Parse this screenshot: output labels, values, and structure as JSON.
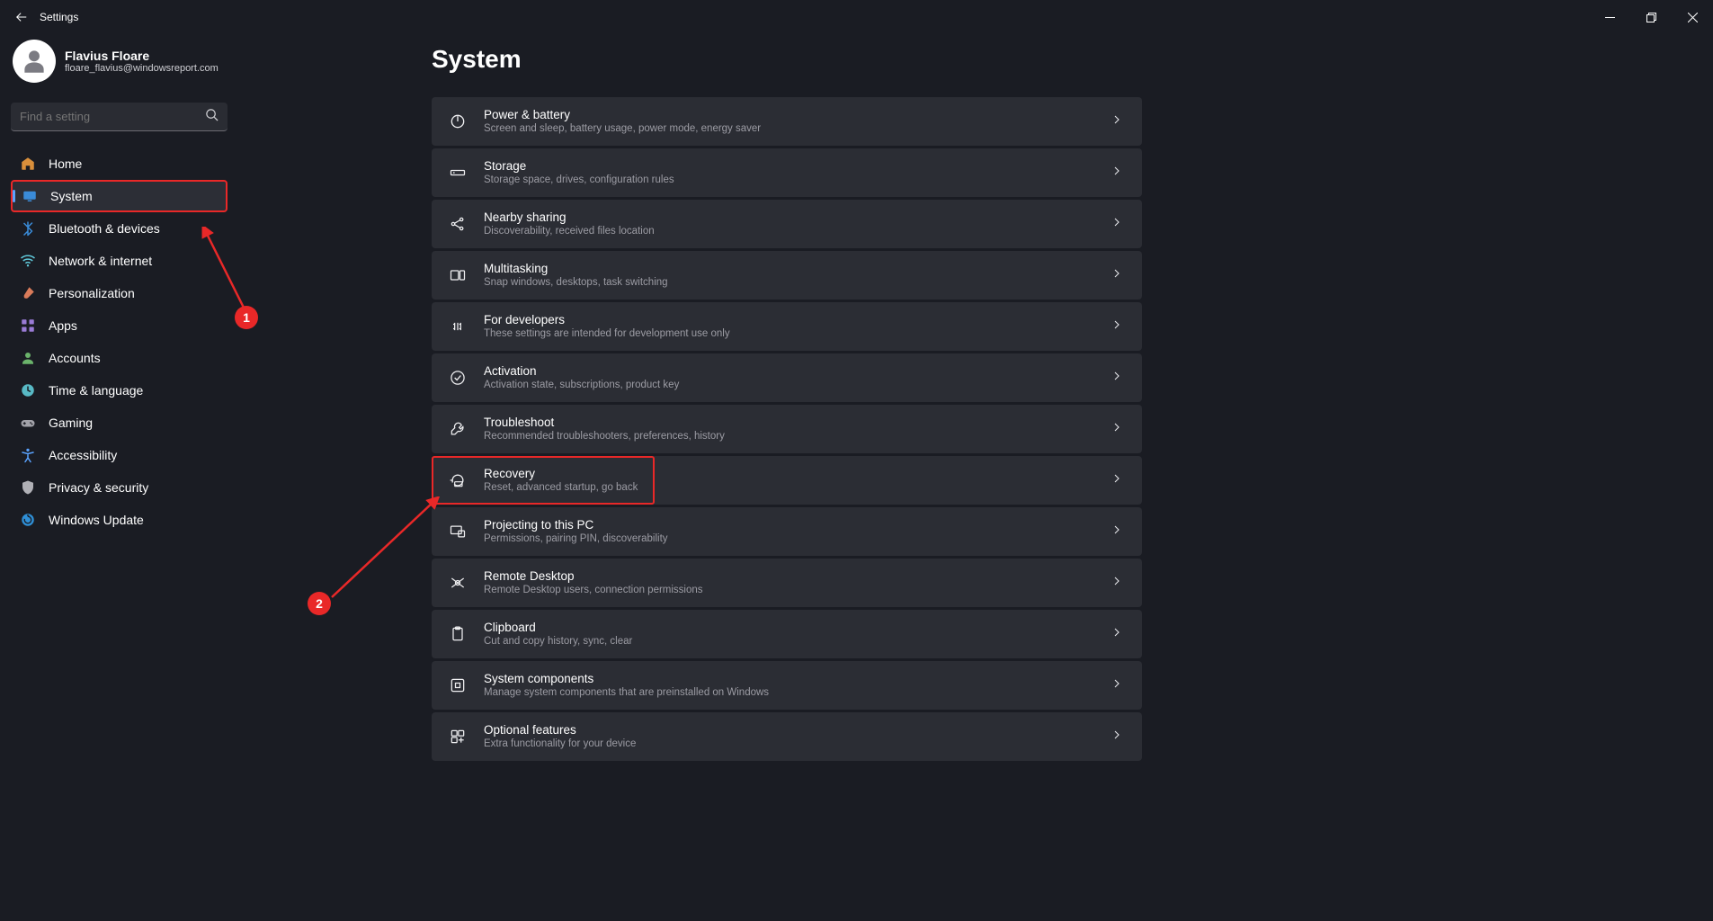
{
  "titlebar": {
    "title": "Settings"
  },
  "profile": {
    "name": "Flavius Floare",
    "email": "floare_flavius@windowsreport.com"
  },
  "search": {
    "placeholder": "Find a setting"
  },
  "nav": [
    {
      "label": "Home",
      "icon": "home",
      "color": "#d98f3b"
    },
    {
      "label": "System",
      "icon": "display",
      "color": "#3a8bd8",
      "selected": true,
      "highlight": true
    },
    {
      "label": "Bluetooth & devices",
      "icon": "bluetooth",
      "color": "#3a8bd8"
    },
    {
      "label": "Network & internet",
      "icon": "wifi",
      "color": "#5fc7d8"
    },
    {
      "label": "Personalization",
      "icon": "brush",
      "color": "#d97b5a"
    },
    {
      "label": "Apps",
      "icon": "apps",
      "color": "#9a7bd6"
    },
    {
      "label": "Accounts",
      "icon": "person",
      "color": "#6bb36b"
    },
    {
      "label": "Time & language",
      "icon": "clock-globe",
      "color": "#58b9c5"
    },
    {
      "label": "Gaming",
      "icon": "gamepad",
      "color": "#a3a3aa"
    },
    {
      "label": "Accessibility",
      "icon": "accessibility",
      "color": "#5aa3ff"
    },
    {
      "label": "Privacy & security",
      "icon": "shield",
      "color": "#b0b0b6"
    },
    {
      "label": "Windows Update",
      "icon": "update",
      "color": "#2f8fd6"
    }
  ],
  "page": {
    "heading": "System"
  },
  "cards": [
    {
      "title": "Power & battery",
      "desc": "Screen and sleep, battery usage, power mode, energy saver",
      "icon": "power"
    },
    {
      "title": "Storage",
      "desc": "Storage space, drives, configuration rules",
      "icon": "storage"
    },
    {
      "title": "Nearby sharing",
      "desc": "Discoverability, received files location",
      "icon": "share"
    },
    {
      "title": "Multitasking",
      "desc": "Snap windows, desktops, task switching",
      "icon": "multitask"
    },
    {
      "title": "For developers",
      "desc": "These settings are intended for development use only",
      "icon": "dev"
    },
    {
      "title": "Activation",
      "desc": "Activation state, subscriptions, product key",
      "icon": "check-circle"
    },
    {
      "title": "Troubleshoot",
      "desc": "Recommended troubleshooters, preferences, history",
      "icon": "wrench"
    },
    {
      "title": "Recovery",
      "desc": "Reset, advanced startup, go back",
      "icon": "recovery",
      "highlight": true
    },
    {
      "title": "Projecting to this PC",
      "desc": "Permissions, pairing PIN, discoverability",
      "icon": "project"
    },
    {
      "title": "Remote Desktop",
      "desc": "Remote Desktop users, connection permissions",
      "icon": "remote"
    },
    {
      "title": "Clipboard",
      "desc": "Cut and copy history, sync, clear",
      "icon": "clipboard"
    },
    {
      "title": "System components",
      "desc": "Manage system components that are preinstalled on Windows",
      "icon": "components"
    },
    {
      "title": "Optional features",
      "desc": "Extra functionality for your device",
      "icon": "optional"
    }
  ],
  "annotations": {
    "badge1": "1",
    "badge2": "2"
  }
}
